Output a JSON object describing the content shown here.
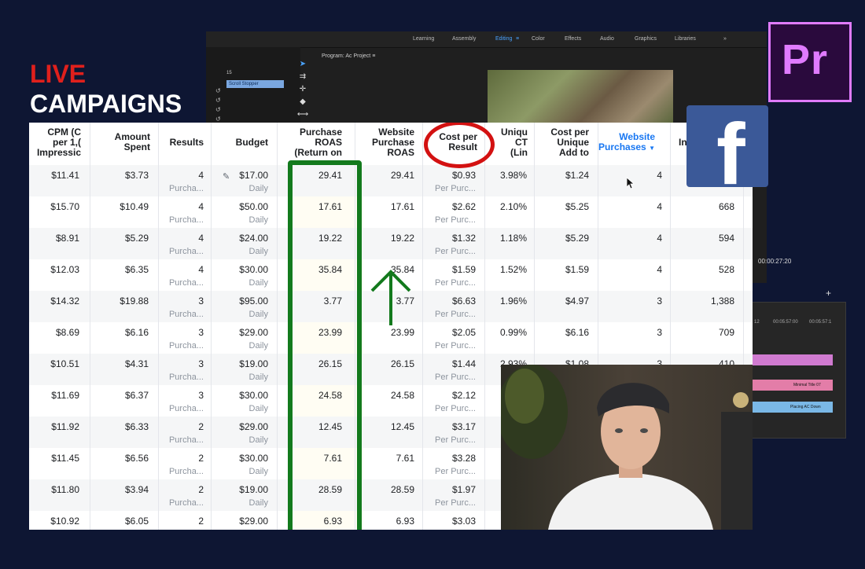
{
  "overlay": {
    "line1": "LIVE",
    "line2": "CAMPAIGNS"
  },
  "premiere": {
    "menu": [
      "Learning",
      "Assembly",
      "Editing",
      "Color",
      "Effects",
      "Audio",
      "Graphics",
      "Libraries"
    ],
    "menu_more": "»",
    "menu_editing_icon": "≡",
    "program_label": "Program: Ac Project",
    "program_menu": "≡",
    "clip_label": "Scroll Stopper",
    "timecode_small": "15",
    "timecode": "00:00:27:20",
    "ruler_a": "12",
    "ruler_b": "00:05:57:00",
    "ruler_c": "00:05:57:1",
    "clip_minimal": "Minimal Title 07",
    "clip_placing": "Placing AC Down",
    "logo_text": "Pr"
  },
  "facebook": {
    "logo_text": "f"
  },
  "table": {
    "headers": {
      "cpm": [
        "CPM (C",
        "per 1,(",
        "Impressic"
      ],
      "amount_spent": [
        "Amount",
        "Spent"
      ],
      "results": [
        "Results"
      ],
      "budget": [
        "Budget"
      ],
      "purchase_roas": [
        "Purchase",
        "ROAS",
        "(Return on"
      ],
      "website_purchase_roas": [
        "Website",
        "Purchase",
        "ROAS"
      ],
      "cost_per_result": [
        "Cost per",
        "Result"
      ],
      "unique_ctr": [
        "Uniqu",
        "CT",
        "(Lin"
      ],
      "cost_per_unique_add": [
        "Cost per",
        "Unique",
        "Add to"
      ],
      "website_purchases": [
        "Website",
        "Purchases"
      ],
      "impressions": [
        "In"
      ]
    },
    "rows": [
      {
        "cpm": "$11.41",
        "spent": "$3.73",
        "results": "4",
        "results_sub": "Purcha...",
        "budget": "$17.00",
        "budget_sub": "Daily",
        "roas": "29.41",
        "wroas": "29.41",
        "cpr": "$0.93",
        "cpr_sub": "Per Purc...",
        "ctr": "3.98%",
        "cpua": "$1.24",
        "wp": "4",
        "imp": ""
      },
      {
        "cpm": "$15.70",
        "spent": "$10.49",
        "results": "4",
        "results_sub": "Purcha...",
        "budget": "$50.00",
        "budget_sub": "Daily",
        "roas": "17.61",
        "wroas": "17.61",
        "cpr": "$2.62",
        "cpr_sub": "Per Purc...",
        "ctr": "2.10%",
        "cpua": "$5.25",
        "wp": "4",
        "imp": "668"
      },
      {
        "cpm": "$8.91",
        "spent": "$5.29",
        "results": "4",
        "results_sub": "Purcha...",
        "budget": "$24.00",
        "budget_sub": "Daily",
        "roas": "19.22",
        "wroas": "19.22",
        "cpr": "$1.32",
        "cpr_sub": "Per Purc...",
        "ctr": "1.18%",
        "cpua": "$5.29",
        "wp": "4",
        "imp": "594"
      },
      {
        "cpm": "$12.03",
        "spent": "$6.35",
        "results": "4",
        "results_sub": "Purcha...",
        "budget": "$30.00",
        "budget_sub": "Daily",
        "roas": "35.84",
        "wroas": "35.84",
        "cpr": "$1.59",
        "cpr_sub": "Per Purc...",
        "ctr": "1.52%",
        "cpua": "$1.59",
        "wp": "4",
        "imp": "528"
      },
      {
        "cpm": "$14.32",
        "spent": "$19.88",
        "results": "3",
        "results_sub": "Purcha...",
        "budget": "$95.00",
        "budget_sub": "Daily",
        "roas": "3.77",
        "wroas": "3.77",
        "cpr": "$6.63",
        "cpr_sub": "Per Purc...",
        "ctr": "1.96%",
        "cpua": "$4.97",
        "wp": "3",
        "imp": "1,388"
      },
      {
        "cpm": "$8.69",
        "spent": "$6.16",
        "results": "3",
        "results_sub": "Purcha...",
        "budget": "$29.00",
        "budget_sub": "Daily",
        "roas": "23.99",
        "wroas": "23.99",
        "cpr": "$2.05",
        "cpr_sub": "Per Purc...",
        "ctr": "0.99%",
        "cpua": "$6.16",
        "wp": "3",
        "imp": "709"
      },
      {
        "cpm": "$10.51",
        "spent": "$4.31",
        "results": "3",
        "results_sub": "Purcha...",
        "budget": "$19.00",
        "budget_sub": "Daily",
        "roas": "26.15",
        "wroas": "26.15",
        "cpr": "$1.44",
        "cpr_sub": "Per Purc...",
        "ctr": "2.93%",
        "cpua": "$1.08",
        "wp": "3",
        "imp": "410"
      },
      {
        "cpm": "$11.69",
        "spent": "$6.37",
        "results": "3",
        "results_sub": "Purcha...",
        "budget": "$30.00",
        "budget_sub": "Daily",
        "roas": "24.58",
        "wroas": "24.58",
        "cpr": "$2.12",
        "cpr_sub": "Per Purc...",
        "ctr": "",
        "cpua": "",
        "wp": "",
        "imp": ""
      },
      {
        "cpm": "$11.92",
        "spent": "$6.33",
        "results": "2",
        "results_sub": "Purcha...",
        "budget": "$29.00",
        "budget_sub": "Daily",
        "roas": "12.45",
        "wroas": "12.45",
        "cpr": "$3.17",
        "cpr_sub": "Per Purc...",
        "ctr": "",
        "cpua": "",
        "wp": "",
        "imp": ""
      },
      {
        "cpm": "$11.45",
        "spent": "$6.56",
        "results": "2",
        "results_sub": "Purcha...",
        "budget": "$30.00",
        "budget_sub": "Daily",
        "roas": "7.61",
        "wroas": "7.61",
        "cpr": "$3.28",
        "cpr_sub": "Per Purc...",
        "ctr": "",
        "cpua": "",
        "wp": "",
        "imp": ""
      },
      {
        "cpm": "$11.80",
        "spent": "$3.94",
        "results": "2",
        "results_sub": "Purcha...",
        "budget": "$19.00",
        "budget_sub": "Daily",
        "roas": "28.59",
        "wroas": "28.59",
        "cpr": "$1.97",
        "cpr_sub": "Per Purc...",
        "ctr": "",
        "cpua": "",
        "wp": "",
        "imp": ""
      },
      {
        "cpm": "$10.92",
        "spent": "$6.05",
        "results": "2",
        "results_sub": "",
        "budget": "$29.00",
        "budget_sub": "",
        "roas": "6.93",
        "wroas": "6.93",
        "cpr": "$3.03",
        "cpr_sub": "",
        "ctr": "",
        "cpua": "",
        "wp": "",
        "imp": ""
      }
    ]
  },
  "colors": {
    "roas_highlight": "#137a1d",
    "cost_circle": "#d31111",
    "fb_blue": "#3b5998",
    "pr_purple": "#e07bff",
    "live_red": "#e0201c"
  }
}
